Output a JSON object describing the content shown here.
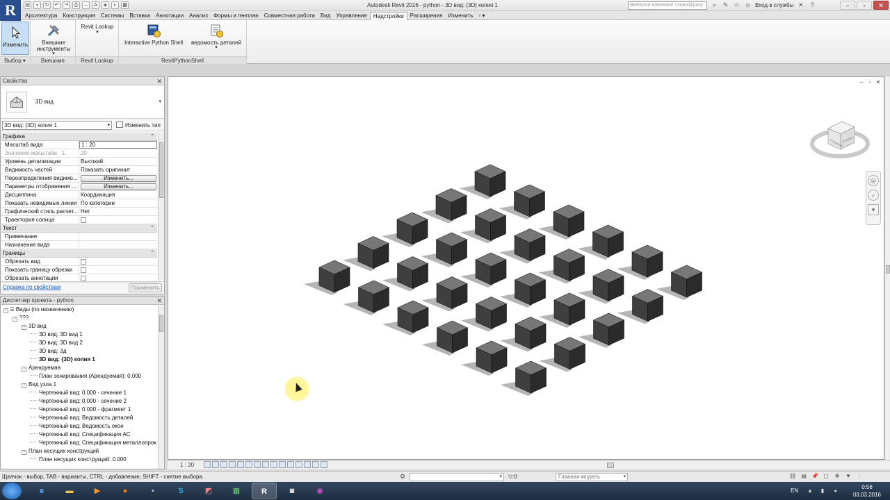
{
  "app": {
    "logo": "R",
    "title": "Autodesk Revit 2016 -    python - 3D вид: {3D} копия 1",
    "search_placeholder": "Введите ключевое слово/фразу",
    "login": "Вход в службы"
  },
  "quick_access": [
    "open-icon",
    "save-icon",
    "sync-icon",
    "undo-icon",
    "redo-icon",
    "print-icon",
    "measure-icon",
    "text-icon",
    "3d-icon",
    "section-icon",
    "close-views-icon"
  ],
  "ribbon": {
    "tabs": [
      {
        "label": "Архитектура"
      },
      {
        "label": "Конструкция"
      },
      {
        "label": "Системы"
      },
      {
        "label": "Вставка"
      },
      {
        "label": "Аннотации"
      },
      {
        "label": "Анализ"
      },
      {
        "label": "Формы и генплан"
      },
      {
        "label": "Совместная работа"
      },
      {
        "label": "Вид"
      },
      {
        "label": "Управление"
      },
      {
        "label": "Надстройки"
      },
      {
        "label": "Расширения"
      },
      {
        "label": "Изменить"
      }
    ],
    "active_tab": "Надстройки",
    "groups": {
      "select": {
        "label": "Выбор",
        "button": "Изменить"
      },
      "external": {
        "label": "Внешние",
        "button_line1": "Внешние",
        "button_line2": "инструменты"
      },
      "lookup": {
        "label": "Revit Lookup",
        "button": "Revit Lookup"
      },
      "pythonshell": {
        "label": "RevitPythonShell",
        "btn_shell": "Interactive Python Shell",
        "btn_details": "ведомость деталей"
      }
    }
  },
  "properties": {
    "title": "Свойства",
    "type_name": "3D вид",
    "instance": "3D вид: {3D} копия 1",
    "edit_type": "Изменить тип",
    "sections": {
      "graphics": "Графика",
      "text": "Текст",
      "extents": "Границы"
    },
    "rows": {
      "scale": {
        "name": "Масштаб вида",
        "value": "1 : 20"
      },
      "scale_value": {
        "name": "Значение масштаба",
        "mid": "1:",
        "value": "20"
      },
      "detail": {
        "name": "Уровень детализации",
        "value": "Высокий"
      },
      "parts": {
        "name": "Видимость частей",
        "value": "Показать оригинал"
      },
      "overrides": {
        "name": "Переопределения видимо...",
        "value": "Изменить..."
      },
      "display": {
        "name": "Параметры отображения ...",
        "value": "Изменить..."
      },
      "discipline": {
        "name": "Дисциплина",
        "value": "Координация"
      },
      "hidden": {
        "name": "Показать невидимые линии",
        "value": "По категории"
      },
      "style": {
        "name": "Графический стиль расчет...",
        "value": "Нет"
      },
      "sun": {
        "name": "Траектория солнца",
        "value": ""
      },
      "note": {
        "name": "Примечание",
        "value": ""
      },
      "purpose": {
        "name": "Назначение вида",
        "value": ""
      },
      "crop": {
        "name": "Обрезать вид",
        "value": ""
      },
      "crop_region": {
        "name": "Показать границу обрезки",
        "value": ""
      },
      "crop_anno": {
        "name": "Обрезать аннотации",
        "value": ""
      }
    },
    "help_link": "Справка по свойствам",
    "apply": "Применить"
  },
  "browser": {
    "title": "Диспетчер проекта - python",
    "nodes": [
      {
        "label": "Виды (по назначению)",
        "depth": 0,
        "toggle": "−",
        "bold": false
      },
      {
        "label": "???",
        "depth": 1,
        "toggle": "−",
        "bold": false
      },
      {
        "label": "3D вид",
        "depth": 2,
        "toggle": "−",
        "bold": false
      },
      {
        "label": "3D вид: 3D вид 1",
        "depth": 3,
        "toggle": "",
        "bold": false
      },
      {
        "label": "3D вид: 3D вид 2",
        "depth": 3,
        "toggle": "",
        "bold": false
      },
      {
        "label": "3D вид: 3д",
        "depth": 3,
        "toggle": "",
        "bold": false
      },
      {
        "label": "3D вид: {3D} копия 1",
        "depth": 3,
        "toggle": "",
        "bold": true
      },
      {
        "label": "Арендуемая",
        "depth": 2,
        "toggle": "−",
        "bold": false
      },
      {
        "label": "План зонирования (Арендуемая): 0.000",
        "depth": 3,
        "toggle": "",
        "bold": false
      },
      {
        "label": "Вид узла 1",
        "depth": 2,
        "toggle": "−",
        "bold": false
      },
      {
        "label": "Чертежный вид: 0.000 - сечение 1",
        "depth": 3,
        "toggle": "",
        "bold": false
      },
      {
        "label": "Чертежный вид: 0.000 - сечение 2",
        "depth": 3,
        "toggle": "",
        "bold": false
      },
      {
        "label": "Чертежный вид: 0.000 - фрагмент 1",
        "depth": 3,
        "toggle": "",
        "bold": false
      },
      {
        "label": "Чертежный вид: Ведомость деталей",
        "depth": 3,
        "toggle": "",
        "bold": false
      },
      {
        "label": "Чертежный вид: Ведомость окон",
        "depth": 3,
        "toggle": "",
        "bold": false
      },
      {
        "label": "Чертежный вид: Спецификация АС",
        "depth": 3,
        "toggle": "",
        "bold": false
      },
      {
        "label": "Чертежный вид: Спецификация металлопрок",
        "depth": 3,
        "toggle": "",
        "bold": false
      },
      {
        "label": "План несущих конструкций",
        "depth": 2,
        "toggle": "−",
        "bold": false
      },
      {
        "label": "План несущих конструкций: 0.000",
        "depth": 3,
        "toggle": "",
        "bold": false
      }
    ]
  },
  "viewcube": {
    "face_front": "Спереди",
    "face_right": "Справа"
  },
  "viewbar": {
    "scale": "1 : 20"
  },
  "status": {
    "text": "Щелчок - выбор, TAB - варианты, CTRL - добавление, SHIFT - снятие выбора.",
    "selection_count": ":0",
    "model": "Главная модель"
  },
  "taskbar": {
    "apps": [
      "start",
      "ie-icon",
      "explorer-icon",
      "media-icon",
      "firefox-icon",
      "save-icon",
      "skype-icon",
      "acrobat-icon",
      "sheet-icon",
      "revit-icon",
      "camera-icon",
      "chrome-icon"
    ],
    "lang": "EN",
    "time": "0:56",
    "date": "03.03.2016"
  },
  "scene": {
    "grid_rows": 5,
    "grid_cols": 6,
    "cube_color": "#3f3f3f"
  }
}
